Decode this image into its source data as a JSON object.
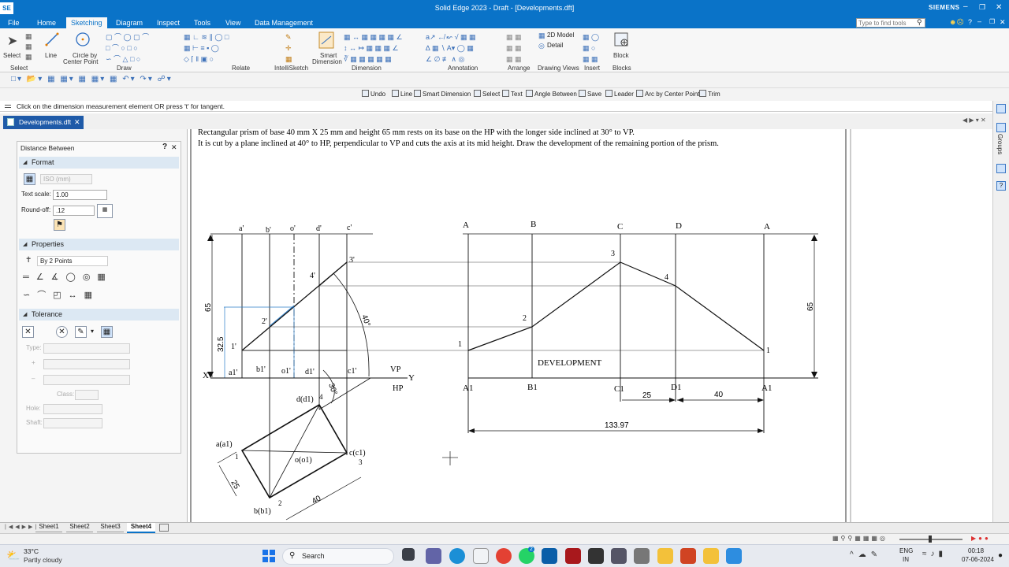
{
  "window": {
    "app_badge": "SE",
    "title": "Solid Edge 2023 - Draft - [Developments.dft]",
    "brand": "SIEMENS",
    "min": "–",
    "restore": "❐",
    "close": "✕"
  },
  "menu": {
    "file": "File",
    "tabs": [
      "Home",
      "Sketching",
      "Diagram",
      "Inspect",
      "Tools",
      "View",
      "Data Management"
    ],
    "active": "Sketching",
    "search_placeholder": "Type to find tools"
  },
  "ribbon": {
    "select_big": "Select",
    "line_big": "Line",
    "circle_big_1": "Circle by",
    "circle_big_2": "Center Point",
    "smart_dim_1": "Smart",
    "smart_dim_2": "Dimension",
    "model2d": "2D Model",
    "detail": "Detail",
    "block": "Block",
    "groups": [
      "Select",
      "Draw",
      "Relate",
      "IntelliSketch",
      "Dimension",
      "Annotation",
      "Arrange",
      "Drawing Views",
      "Insert",
      "Blocks"
    ]
  },
  "command_bar": {
    "items": [
      "Undo",
      "Line",
      "Smart Dimension",
      "Select",
      "Text",
      "Angle Between",
      "Save",
      "Leader",
      "Arc by Center Point",
      "Trim"
    ]
  },
  "prompt": "Click on the dimension measurement element  OR press 't' for tangent.",
  "doc_tab": "Developments.dft",
  "panel": {
    "title": "Distance Between",
    "help": "?",
    "close": "✕",
    "format_header": "Format",
    "style_value": "ISO (mm)",
    "text_scale_label": "Text scale:",
    "text_scale_value": "1.00",
    "roundoff_label": "Round-off:",
    "roundoff_value": ".12",
    "properties_header": "Properties",
    "by_points": "By 2 Points",
    "tolerance_header": "Tolerance",
    "type_label": "Type:",
    "plus_label": "+",
    "minus_label": "–",
    "class_label": "Class:",
    "hole_label": "Hole:",
    "shaft_label": "Shaft:"
  },
  "drawing": {
    "problem_line1": "Rectangular prism of base 40 mm X 25 mm and height 65 mm rests on its base on the HP with the longer side inclined at 30° to VP.",
    "problem_line2": "It is cut by a plane inclined at 40° to HP, perpendicular to VP and cuts the axis at its mid height. Draw the development of the remaining portion of the prism.",
    "fv_top_labels": [
      "a'",
      "b'",
      "o'",
      "d'",
      "c'"
    ],
    "fv_cut_labels": [
      "3'",
      "4'",
      "2'",
      "1'"
    ],
    "fv_base_labels": [
      "a1'",
      "b1'",
      "o1'",
      "d1'",
      "c1'"
    ],
    "x_label": "X",
    "y_label": "Y",
    "vp_label": "VP",
    "hp_label": "HP",
    "dim_65_left": "65",
    "dim_325": "32.5",
    "angle_40": "40°",
    "angle_30": "30°",
    "tv_labels": [
      "a(a1)",
      "b(b1)",
      "c(c1)",
      "d(d1)",
      "o(o1)"
    ],
    "tv_numbers": [
      "1",
      "2",
      "3",
      "4"
    ],
    "dim_25_tv": "25",
    "dim_40_tv": "40",
    "dev_top_labels": [
      "A",
      "B",
      "C",
      "D",
      "A"
    ],
    "dev_bottom_labels": [
      "A1",
      "B1",
      "C1",
      "D1",
      "A1"
    ],
    "dev_points": [
      "1",
      "2",
      "3",
      "4",
      "1"
    ],
    "development_label": "DEVELOPMENT",
    "dim_65_right": "65",
    "dim_25_dev": "25",
    "dim_40_dev": "40",
    "dim_total": "133.97"
  },
  "right_tabs": {
    "groups": "Groups"
  },
  "sheets": {
    "tabs": [
      "Sheet1",
      "Sheet2",
      "Sheet3",
      "Sheet4"
    ],
    "active": "Sheet4"
  },
  "taskbar": {
    "temperature": "33°C",
    "weather": "Partly cloudy",
    "search": "Search",
    "lang1": "ENG",
    "lang2": "IN",
    "time": "00:18",
    "date": "07-06-2024",
    "badge": "2"
  },
  "colors": {
    "accent": "#0a73c8",
    "panel_section": "#dce8f3",
    "construction": "#2a7dc9"
  }
}
